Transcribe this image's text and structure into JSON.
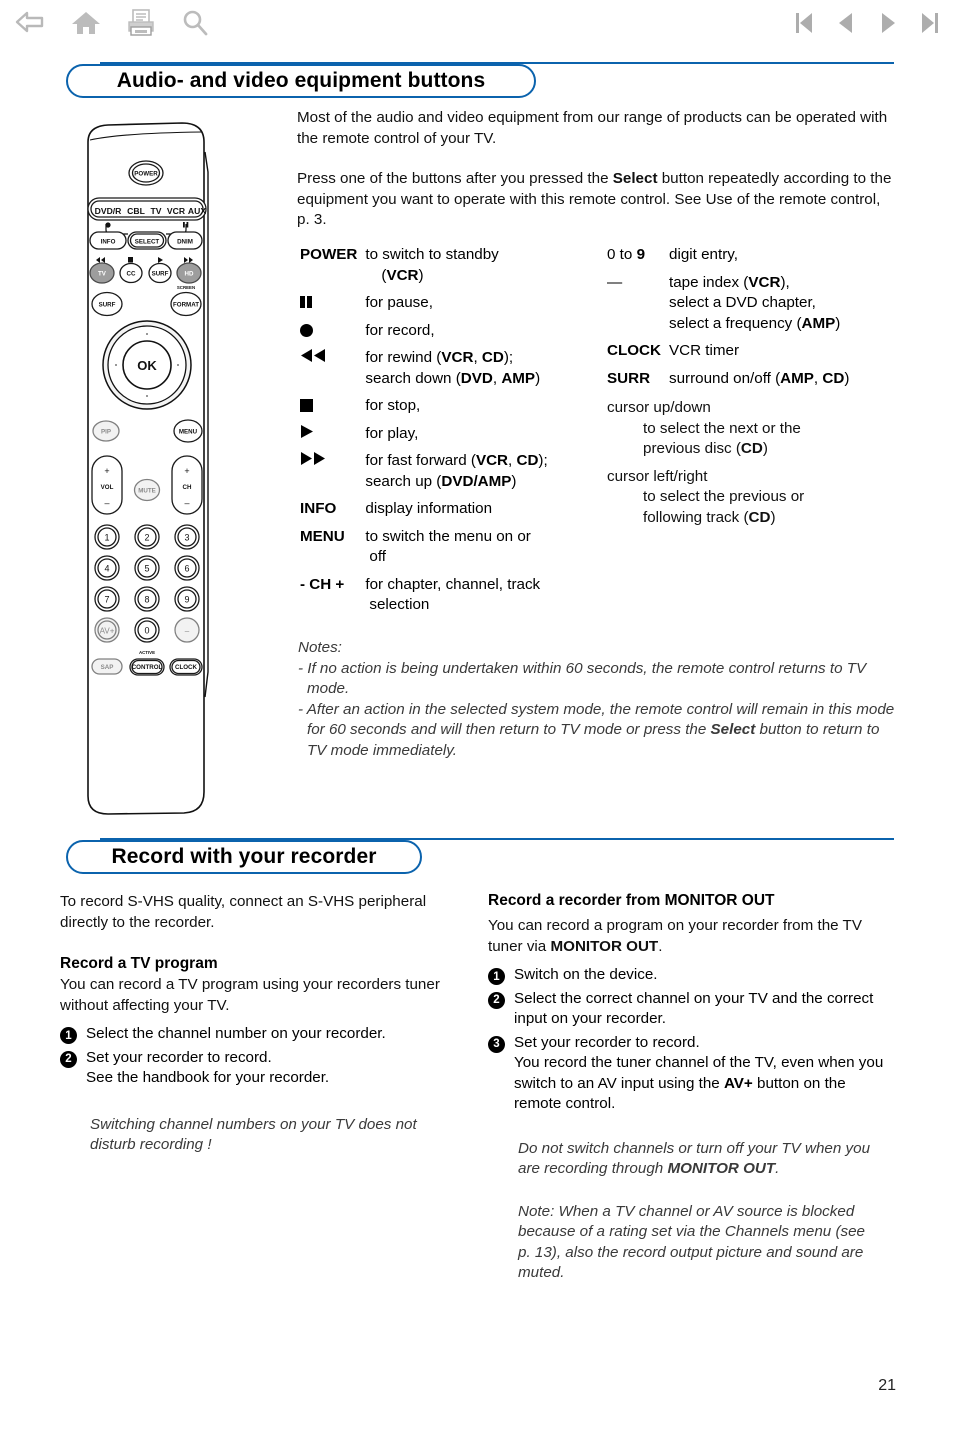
{
  "toolbar": {
    "icons_left": [
      {
        "name": "back-icon",
        "label": "Back"
      },
      {
        "name": "home-icon",
        "label": "Home"
      },
      {
        "name": "print-icon",
        "label": "Print"
      },
      {
        "name": "search-icon",
        "label": "Search"
      }
    ],
    "icons_right": [
      {
        "name": "first-page-icon",
        "label": "First page"
      },
      {
        "name": "previous-page-icon",
        "label": "Previous page"
      },
      {
        "name": "next-page-icon",
        "label": "Next page"
      },
      {
        "name": "last-page-icon",
        "label": "Last page"
      }
    ],
    "accent_color": "#0b63ad",
    "icon_color": "#b0b0b0"
  },
  "section1": {
    "heading": "Audio- and video equipment buttons",
    "intro1": "Most of the audio and video equipment from our range of products can be operated with the remote control of your TV.",
    "intro2_a": "Press one of the buttons after you pressed the ",
    "intro2_bold": "Select",
    "intro2_b": " button repeatedly according to the equipment you want to operate with this remote control. See Use of the remote control, p. 3.",
    "left_column": [
      {
        "term": "POWER",
        "term_bold": true,
        "desc": "to switch to standby (VCR)"
      },
      {
        "term": "▐▌",
        "glyph": "pause",
        "desc": "for pause,"
      },
      {
        "term": "●",
        "glyph": "record",
        "desc": "for record,"
      },
      {
        "term": "◀◀",
        "glyph": "rewind",
        "desc": "for rewind (VCR, CD); search down (DVD, AMP)"
      },
      {
        "term": "■",
        "glyph": "stop",
        "desc": "for stop,"
      },
      {
        "term": "▶",
        "glyph": "play",
        "desc": "for play,"
      },
      {
        "term": "▶▶",
        "glyph": "fast-forward",
        "desc": "for fast forward (VCR, CD); search up (DVD/AMP)"
      },
      {
        "term": "INFO",
        "term_bold": true,
        "desc": "display information"
      },
      {
        "term": "MENU",
        "term_bold": true,
        "desc": "to switch the menu on or off"
      },
      {
        "term": "- CH +",
        "term_bold": true,
        "desc": "for chapter, channel, track selection"
      }
    ],
    "right_column": [
      {
        "term": "0 to 9",
        "desc": "digit entry,"
      },
      {
        "term": "—",
        "desc": "tape index (VCR), select a DVD chapter, select a frequency (AMP)"
      },
      {
        "term": "CLOCK",
        "term_bold": true,
        "desc": "VCR timer"
      },
      {
        "term": "SURR",
        "term_bold": true,
        "desc": "surround on/off (AMP, CD)"
      },
      {
        "term": "cursor up/down",
        "desc": "to select the next or the previous disc (CD)"
      },
      {
        "term": "cursor left/right",
        "desc": "to select the previous or following track (CD)"
      }
    ],
    "notes_title": "Notes:",
    "note1": "- If no action is being undertaken within 60 seconds, the remote control returns to TV mode.",
    "note2_a": "- After an action in the selected system mode, the remote control will remain in this mode for 60 seconds and will then return to TV mode or press the ",
    "note2_bold": "Select",
    "note2_b": " button to return to TV mode immediately."
  },
  "remote": {
    "power_label": "POWER",
    "mode_bar": [
      "DVD/R",
      "CBL",
      "TV",
      "VCR",
      "AUX"
    ],
    "row_info": [
      "INFO",
      "SELECT",
      "DNIM"
    ],
    "row_info_glyphs": [
      "record",
      "pause"
    ],
    "row_tv": [
      "TV",
      "CC",
      "SURF",
      "HD"
    ],
    "row_tv_glyphs": [
      "rewind",
      "stop",
      "play",
      "fast-forward"
    ],
    "surf_label": "SURF",
    "screen_small": "SCREEN",
    "format_label": "FORMAT",
    "ok_label": "OK",
    "pip_label": "PIP",
    "menu_label": "MENU",
    "vol_label": "VOL",
    "mute_label": "MUTE",
    "ch_label": "CH",
    "plus": "+",
    "minus": "–",
    "keypad": [
      "1",
      "2",
      "3",
      "4",
      "5",
      "6",
      "7",
      "8",
      "9",
      "AV+",
      "0",
      "–"
    ],
    "active_small": "ACTIVE",
    "bottom_row": [
      "SAP",
      "CONTROL",
      "CLOCK"
    ]
  },
  "section2": {
    "heading": "Record with your recorder",
    "left": {
      "intro": "To record S-VHS quality, connect an S-VHS peripheral directly to the recorder.",
      "subheading": "Record a TV program",
      "para": "You can record a TV program using your recorders tuner without affecting your TV.",
      "steps": [
        {
          "num": "1",
          "text": "Select the channel number on your recorder."
        },
        {
          "num": "2",
          "text": "Set your recorder to record.\nSee the handbook for your recorder."
        }
      ],
      "note": "Switching channel numbers on your TV does not disturb recording !"
    },
    "right": {
      "subheading_a": "Record a recorder from ",
      "subheading_b": "MONITOR OUT",
      "para_a": "You can record a program on your recorder from the TV tuner via ",
      "para_bold": "MONITOR OUT",
      "para_b": ".",
      "steps": [
        {
          "num": "1",
          "text": "Switch on the device."
        },
        {
          "num": "2",
          "text": "Select the correct channel on your TV and the correct input on your recorder."
        },
        {
          "num": "3",
          "text": "Set your recorder to record.\nYou record the tuner channel of the TV, even when you switch to an AV input using the AV+ button on the remote control.",
          "bold_token": "AV+"
        }
      ],
      "note1_a": "Do not switch channels or turn off your TV when you are recording through ",
      "note1_bold": "MONITOR OUT",
      "note1_b": ".",
      "note2": "Note: When a TV channel or AV source is blocked because of a rating set via the Channels menu (see p. 13), also the record output picture and sound are muted."
    }
  },
  "footer": {
    "page_number": "21"
  }
}
